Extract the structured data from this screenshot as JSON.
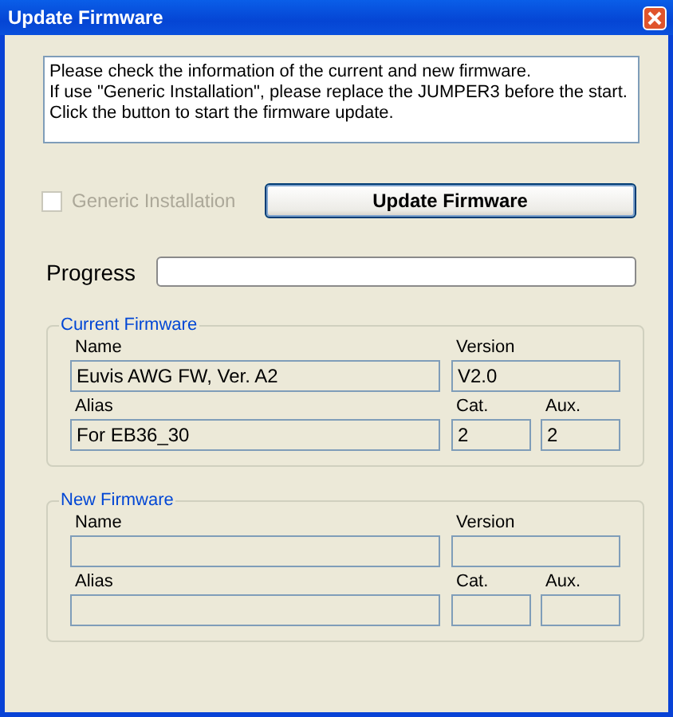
{
  "window": {
    "title": "Update Firmware"
  },
  "info_text": [
    "Please check the information of the current and new firmware.",
    "If use \"Generic Installation\", please replace the JUMPER3 before the start.",
    "Click the button to start the firmware update."
  ],
  "generic_installation": {
    "label": "Generic Installation",
    "checked": false,
    "disabled": true
  },
  "update_button": "Update Firmware",
  "progress": {
    "label": "Progress",
    "level": 0
  },
  "groups": [
    {
      "title": "Current Firmware",
      "fields": [
        {
          "label": "Name",
          "value": "Euvis AWG FW, Ver. A2"
        },
        {
          "label": "Version",
          "value": "V2.0"
        },
        {
          "label": "Alias",
          "value": "For EB36_30"
        },
        {
          "label": "Cat.",
          "value": "2"
        },
        {
          "label": "Aux.",
          "value": "2"
        }
      ]
    },
    {
      "title": "New Firmware",
      "fields": [
        {
          "label": "Name"
        },
        {
          "label": "Version"
        },
        {
          "label": "Alias"
        },
        {
          "label": "Cat."
        },
        {
          "label": "Aux."
        }
      ]
    }
  ]
}
